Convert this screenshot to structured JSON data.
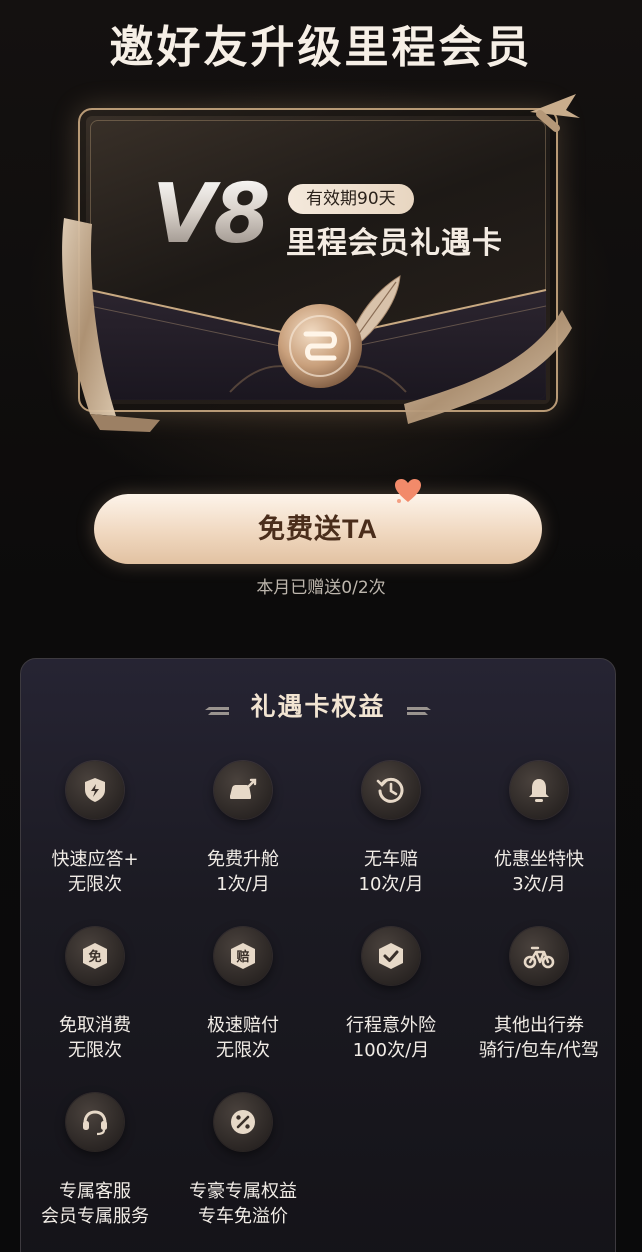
{
  "page": {
    "title": "邀好友升级里程会员"
  },
  "card": {
    "level": "V8",
    "validity": "有效期90天",
    "name": "里程会员礼遇卡"
  },
  "cta": {
    "label": "免费送TA",
    "gift_count_text": "本月已赠送0/2次"
  },
  "benefits": {
    "title": "礼遇卡权益",
    "items": [
      {
        "icon": "lightning-shield-icon",
        "name": "快速应答+",
        "detail": "无限次"
      },
      {
        "icon": "car-upgrade-icon",
        "name": "免费升舱",
        "detail": "1次/月"
      },
      {
        "icon": "history-clock-icon",
        "name": "无车赔",
        "detail": "10次/月"
      },
      {
        "icon": "bell-icon",
        "name": "优惠坐特快",
        "detail": "3次/月"
      },
      {
        "icon": "free-badge-icon",
        "icon_char": "免",
        "name": "免取消费",
        "detail": "无限次"
      },
      {
        "icon": "compensation-badge-icon",
        "icon_char": "赔",
        "name": "极速赔付",
        "detail": "无限次"
      },
      {
        "icon": "check-shield-icon",
        "name": "行程意外险",
        "detail": "100次/月"
      },
      {
        "icon": "bike-icon",
        "name": "其他出行券",
        "detail": "骑行/包车/代驾"
      },
      {
        "icon": "headset-icon",
        "name": "专属客服",
        "detail": "会员专属服务"
      },
      {
        "icon": "discount-icon",
        "name": "专豪专属权益",
        "detail": "专车免溢价"
      }
    ]
  },
  "colors": {
    "background": "#0b0a0a",
    "gold": "#d9b98f",
    "cta_text": "#4a2d1b",
    "panel": "#1b1a22"
  }
}
